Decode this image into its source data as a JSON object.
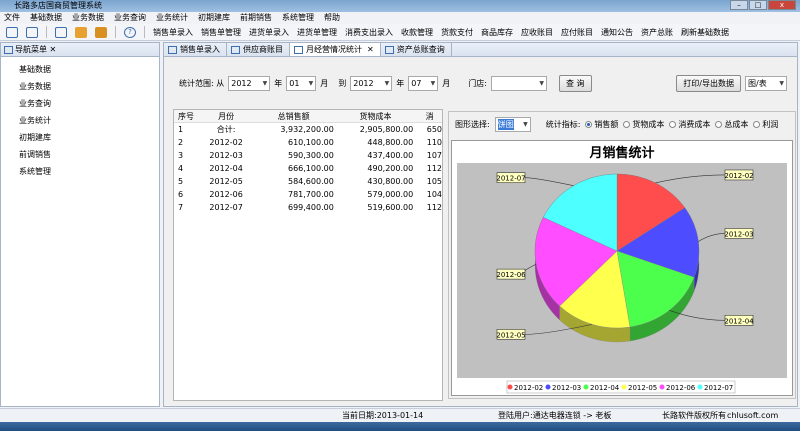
{
  "window": {
    "title": "长路多店国商贸管理系统"
  },
  "menu": [
    "文件",
    "基础数据",
    "业务数据",
    "业务查询",
    "业务统计",
    "初期建库",
    "前期销售",
    "系统管理",
    "帮助"
  ],
  "toolbar": [
    "销售单录入",
    "销售单管理",
    "进货单录入",
    "进货单管理",
    "消费支出录入",
    "收款管理",
    "货款支付",
    "商品库存",
    "应收账目",
    "应付账目",
    "通知公告",
    "资产总账",
    "刷新基础数据"
  ],
  "nav": {
    "title": "导航菜单",
    "items": [
      "基础数据",
      "业务数据",
      "业务查询",
      "业务统计",
      "初期建库",
      "前调销售",
      "系统管理"
    ]
  },
  "tabs": [
    "销售单录入",
    "供应商账目",
    "月经营情况统计",
    "资产总账查询"
  ],
  "filter": {
    "range_label": "统计范围: 从",
    "from_year": "2012",
    "year": "年",
    "from_month": "01",
    "month": "月",
    "to": "到",
    "to_year": "2012",
    "to_month": "07",
    "store_label": "门店:",
    "store_value": "",
    "query": "查 询",
    "print": "打印/导出数据",
    "view": "图/表"
  },
  "table": {
    "headers": [
      "序号",
      "月份",
      "总销售额",
      "货物成本",
      "消"
    ],
    "rows": [
      [
        "1",
        "合计:",
        "3,932,200.00",
        "2,905,800.00",
        "650"
      ],
      [
        "2",
        "2012-02",
        "610,100.00",
        "448,800.00",
        "110"
      ],
      [
        "3",
        "2012-03",
        "590,300.00",
        "437,400.00",
        "107"
      ],
      [
        "4",
        "2012-04",
        "666,100.00",
        "490,200.00",
        "112"
      ],
      [
        "5",
        "2012-05",
        "584,600.00",
        "430,800.00",
        "105"
      ],
      [
        "6",
        "2012-06",
        "781,700.00",
        "579,000.00",
        "104"
      ],
      [
        "7",
        "2012-07",
        "699,400.00",
        "519,600.00",
        "112"
      ]
    ]
  },
  "chart_controls": {
    "type_label": "图形选择:",
    "type_value": "饼图",
    "metric_label": "统计指标:",
    "metrics": [
      "销售额",
      "货物成本",
      "消费成本",
      "总成本",
      "利润"
    ],
    "selected": 0
  },
  "chart_data": {
    "type": "pie",
    "title": "月销售统计",
    "categories": [
      "2012-02",
      "2012-03",
      "2012-04",
      "2012-05",
      "2012-06",
      "2012-07"
    ],
    "values": [
      610100,
      590300,
      666100,
      584600,
      781700,
      699400
    ],
    "colors": [
      "#ff4d4d",
      "#4d4dff",
      "#4dff4d",
      "#ffff4d",
      "#ff4dff",
      "#4dffff"
    ],
    "legend": "bottom"
  },
  "status": {
    "date": "当前日期:2013-01-14",
    "user": "登陆用户:通达电器连锁 -> 老板",
    "copyright": "长路软件版权所有",
    "site": "chlusoft.com"
  }
}
